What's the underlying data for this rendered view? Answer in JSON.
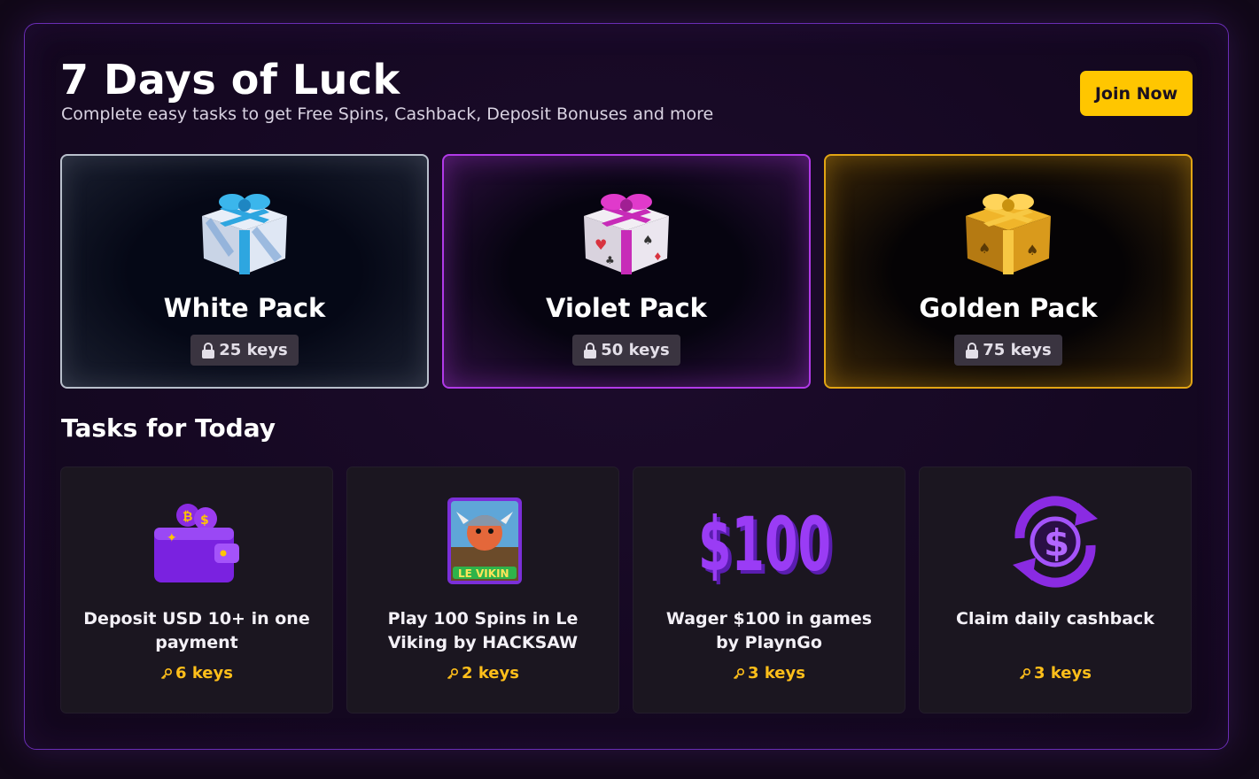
{
  "header": {
    "title": "7 Days of Luck",
    "subtitle": "Complete easy tasks to get Free Spins, Cashback, Deposit Bonuses and more",
    "join_label": "Join Now"
  },
  "packs": [
    {
      "name": "White Pack",
      "keys": "25 keys",
      "icon": "white-gift-icon",
      "accent": "#b9c0cc"
    },
    {
      "name": "Violet Pack",
      "keys": "50 keys",
      "icon": "violet-gift-icon",
      "accent": "#b13ae8"
    },
    {
      "name": "Golden Pack",
      "keys": "75 keys",
      "icon": "golden-gift-icon",
      "accent": "#e2a514"
    }
  ],
  "tasks_section": {
    "title": "Tasks for Today",
    "tasks": [
      {
        "text": "Deposit USD 10+ in one payment",
        "keys": "6 keys",
        "icon": "wallet-icon"
      },
      {
        "text": "Play 100 Spins in Le Viking by HACKSAW",
        "keys": "2 keys",
        "icon": "le-viking-game-icon"
      },
      {
        "text": "Wager $100 in games by PlaynGo",
        "keys": "3 keys",
        "icon": "dollar-100-icon"
      },
      {
        "text": "Claim daily cashback",
        "keys": "3 keys",
        "icon": "cashback-icon"
      }
    ]
  },
  "colors": {
    "join_button": "#ffc600",
    "keys_accent": "#ffbf1a",
    "panel_border": "#6a2db5"
  }
}
